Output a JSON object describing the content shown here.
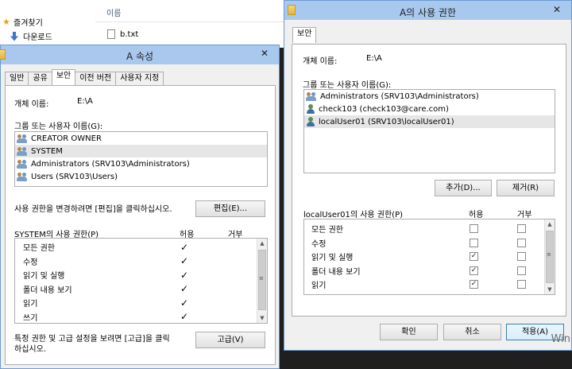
{
  "explorer": {
    "favorites_label": "즐겨찾기",
    "downloads_label": "다운로드",
    "column_name": "이름",
    "file_name": "b.txt"
  },
  "left_dialog": {
    "title": "A 속성",
    "tabs": [
      "일반",
      "공유",
      "보안",
      "이전 버전",
      "사용자 지정"
    ],
    "active_tab_index": 2,
    "object_name_label": "개체 이름:",
    "object_name_value": "E:\\A",
    "group_label": "그룹 또는 사용자 이름(G):",
    "users": [
      {
        "name": "CREATOR OWNER",
        "icon": "group-icon"
      },
      {
        "name": "SYSTEM",
        "icon": "group-icon",
        "selected": true
      },
      {
        "name": "Administrators (SRV103\\Administrators)",
        "icon": "group-icon"
      },
      {
        "name": "Users (SRV103\\Users)",
        "icon": "group-icon"
      }
    ],
    "edit_hint": "사용 권한을 변경하려면 [편집]을 클릭하십시오.",
    "edit_button": "편집(E)...",
    "perm_label": "SYSTEM의 사용 권한(P)",
    "allow_header": "허용",
    "deny_header": "거부",
    "permissions": [
      {
        "name": "모든 권한",
        "allow": true,
        "deny": false
      },
      {
        "name": "수정",
        "allow": true,
        "deny": false
      },
      {
        "name": "읽기 및 실행",
        "allow": true,
        "deny": false
      },
      {
        "name": "폴더 내용 보기",
        "allow": true,
        "deny": false
      },
      {
        "name": "읽기",
        "allow": true,
        "deny": false
      },
      {
        "name": "쓰기",
        "allow": true,
        "deny": false
      }
    ],
    "advanced_hint_line1": "특정 권한 및 고급 설정을 보려면 [고급]을 클릭",
    "advanced_hint_line2": "하십시오.",
    "advanced_button": "고급(V)"
  },
  "right_dialog": {
    "title": "A의 사용 권한",
    "tab": "보안",
    "object_name_label": "개체 이름:",
    "object_name_value": "E:\\A",
    "group_label": "그룹 또는 사용자 이름(G):",
    "users": [
      {
        "name": "Administrators (SRV103\\Administrators)",
        "icon": "group-icon"
      },
      {
        "name": "check103 (check103@care.com)",
        "icon": "user-icon"
      },
      {
        "name": "localUser01 (SRV103\\localUser01)",
        "icon": "user-icon",
        "selected": true
      }
    ],
    "add_button": "추가(D)...",
    "remove_button": "제거(R)",
    "perm_label": "localUser01의 사용 권한(P)",
    "allow_header": "허용",
    "deny_header": "거부",
    "permissions": [
      {
        "name": "모든 권한",
        "allow": false,
        "deny": false
      },
      {
        "name": "수정",
        "allow": false,
        "deny": false
      },
      {
        "name": "읽기 및 실행",
        "allow": true,
        "deny": false
      },
      {
        "name": "폴더 내용 보기",
        "allow": true,
        "deny": false
      },
      {
        "name": "읽기",
        "allow": true,
        "deny": false
      }
    ],
    "ok_button": "확인",
    "cancel_button": "취소",
    "apply_button": "적용(A)"
  },
  "watermark": "Win"
}
